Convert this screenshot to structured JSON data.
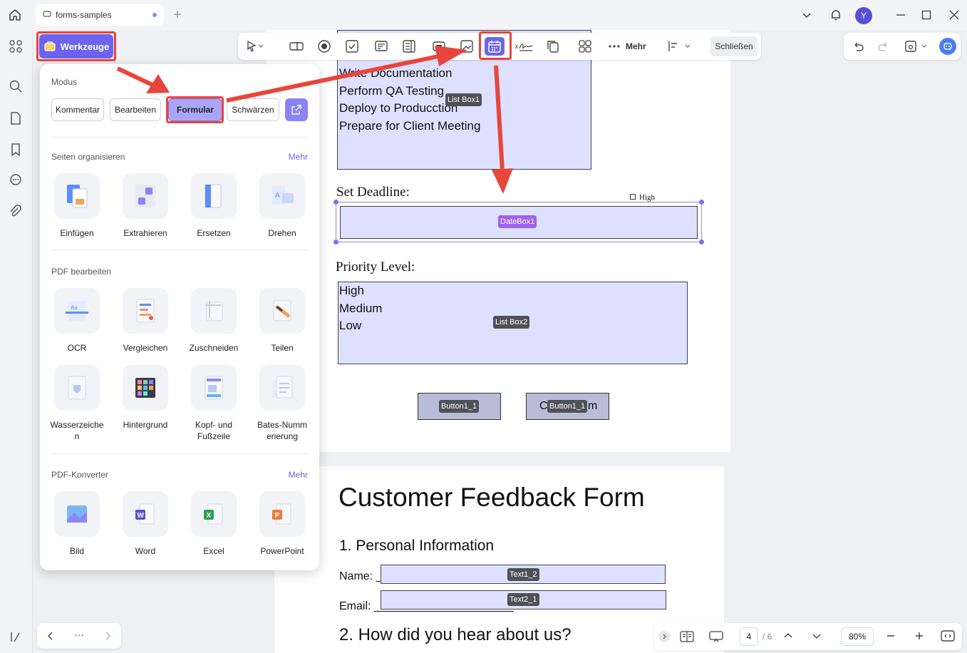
{
  "titlebar": {
    "tab_title": "forms-samples",
    "new_tab": "+",
    "avatar_letter": "Y"
  },
  "toolbar": {
    "werkzeuge_label": "Werkzeuge",
    "mehr_label": "Mehr",
    "schliessen_label": "Schließen",
    "signature_prefix": "x"
  },
  "panel": {
    "modus_title": "Modus",
    "modes": [
      "Kommentar",
      "Bearbeiten",
      "Formular",
      "Schwärzen"
    ],
    "organize_title": "Seiten organisieren",
    "organize_more": "Mehr",
    "organize_tools": [
      "Einfügen",
      "Extrahieren",
      "Ersetzen",
      "Drehen"
    ],
    "edit_title": "PDF bearbeiten",
    "edit_tools": [
      "OCR",
      "Vergleichen",
      "Zuschneiden",
      "Teilen"
    ],
    "edit_tools2": [
      "Wasserzeiche\nn",
      "Hintergrund",
      "Kopf- und\nFußzeile",
      "Bates-Numm\nerierung"
    ],
    "convert_title": "PDF-Konverter",
    "convert_more": "Mehr",
    "convert_tools": [
      "Bild",
      "Word",
      "Excel",
      "PowerPoint"
    ]
  },
  "document": {
    "list_items": [
      "Write Documentation",
      "Perform QA Testing",
      "Deploy to Producction",
      "Prepare for Client Meeting"
    ],
    "list_box1_tag": "List Box1",
    "set_deadline": "Set Deadline:",
    "high_checkbox_label": "High",
    "datebox_tag": "DateBox1",
    "priority_label": "Priority Level:",
    "priority_items": [
      "High",
      "Medium",
      "Low"
    ],
    "list_box2_tag": "List Box2",
    "button_tag": "Button1_1",
    "button2_text_left": "C",
    "button2_text_right": "m",
    "form_title": "Customer Feedback Form",
    "section1": "1. Personal Information",
    "name_label": "Name: _",
    "text1_tag": "Text1_2",
    "email_label": "Email: ______________________",
    "text2_tag": "Text2_1",
    "section2": "2. How did you hear about us?"
  },
  "statusbar": {
    "page_current": "4",
    "page_total": "/ 6",
    "zoom": "80%"
  },
  "bottomnav": {
    "more": "···"
  },
  "colors": {
    "accent": "#6c63f0",
    "highlight": "#e8453c",
    "field_fill": "#dde1ff",
    "mode_active": "#a9a6f8"
  }
}
